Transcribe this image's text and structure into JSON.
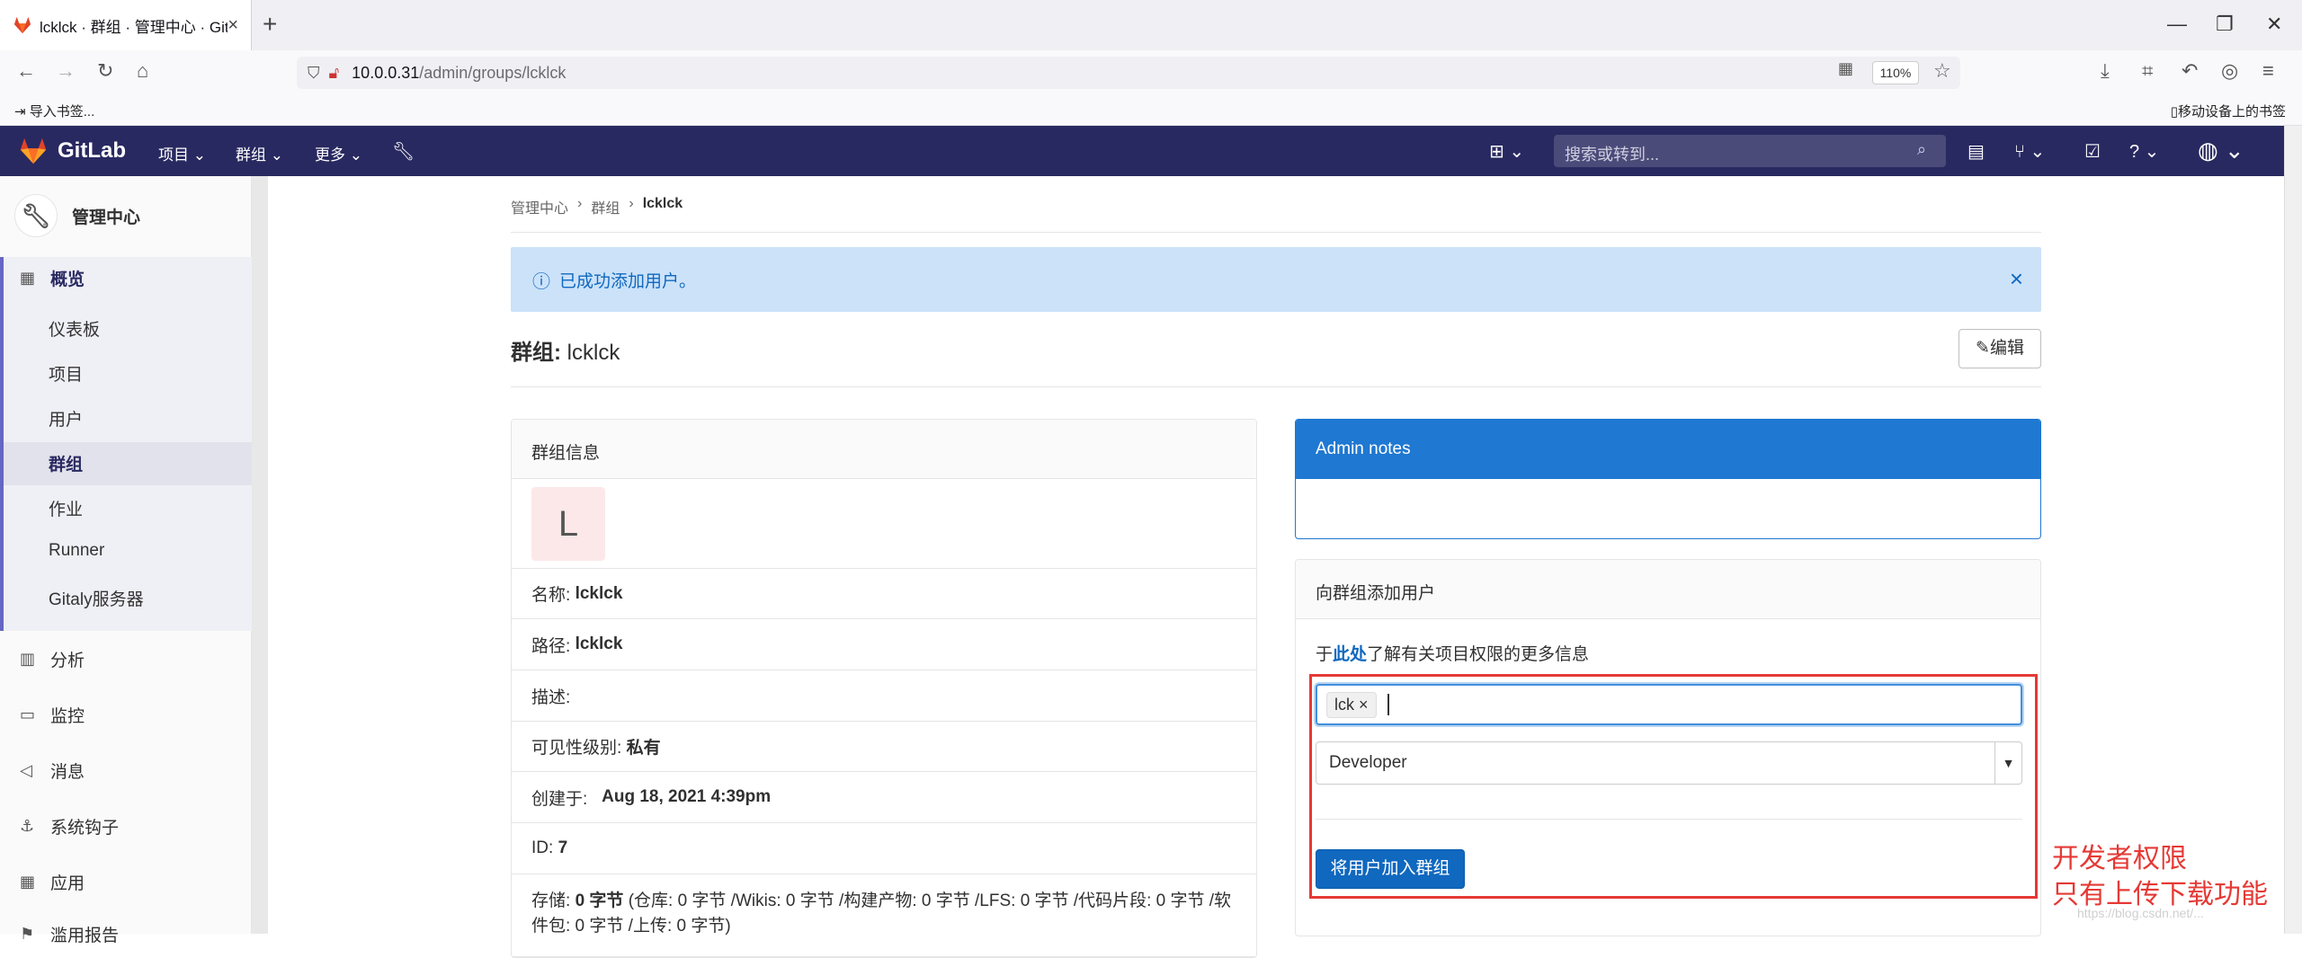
{
  "browser": {
    "tab_title": "lcklck · 群组 · 管理中心 · GitLab",
    "url_host": "10.0.0.31",
    "url_path": "/admin/groups/lcklck",
    "zoom": "110%",
    "bookmark_import": "导入书签...",
    "bookmark_mobile": "移动设备上的书签"
  },
  "gitlab_header": {
    "brand": "GitLab",
    "menu": [
      "项目",
      "群组",
      "更多"
    ],
    "search_placeholder": "搜索或转到..."
  },
  "sidebar": {
    "title": "管理中心",
    "overview": "概览",
    "sub_items": [
      "仪表板",
      "项目",
      "用户",
      "群组",
      "作业",
      "Runner",
      "Gitaly服务器"
    ],
    "active": "群组",
    "sections": [
      "分析",
      "监控",
      "消息",
      "系统钩子",
      "应用",
      "滥用报告"
    ]
  },
  "breadcrumb": [
    "管理中心",
    "群组",
    "lcklck"
  ],
  "alert": {
    "text": "已成功添加用户。"
  },
  "page": {
    "title_label": "群组:",
    "title_name": "lcklck",
    "edit_button": "编辑"
  },
  "group_info": {
    "header": "群组信息",
    "avatar_letter": "L",
    "name_label": "名称:",
    "name_value": "lcklck",
    "path_label": "路径:",
    "path_value": "lcklck",
    "description_label": "描述:",
    "visibility_label": "可见性级别:",
    "visibility_value": "私有",
    "created_label": "创建于:",
    "created_value": "Aug 18, 2021 4:39pm",
    "id_label": "ID:",
    "id_value": "7",
    "storage_label": "存储:",
    "storage_value": "0 字节",
    "storage_detail": "(仓库: 0 字节 /Wikis: 0 字节 /构建产物: 0 字节 /LFS: 0 字节 /代码片段: 0 字节 /软件包: 0 字节 /上传: 0 字节)"
  },
  "admin_notes": {
    "header": "Admin notes"
  },
  "add_user": {
    "header": "向群组添加用户",
    "help_prefix": "于",
    "help_link": "此处",
    "help_suffix": "了解有关项目权限的更多信息",
    "selected_user": "lck",
    "role": "Developer",
    "submit": "将用户加入群组"
  },
  "annotation": {
    "line1": "开发者权限",
    "line2": "只有上传下载功能",
    "color": "#e53935"
  },
  "watermark": "https://blog.csdn.net/...",
  "colors": {
    "header_bg": "#292961",
    "accent": "#1068bf",
    "alert_bg": "#cbe2f9"
  }
}
